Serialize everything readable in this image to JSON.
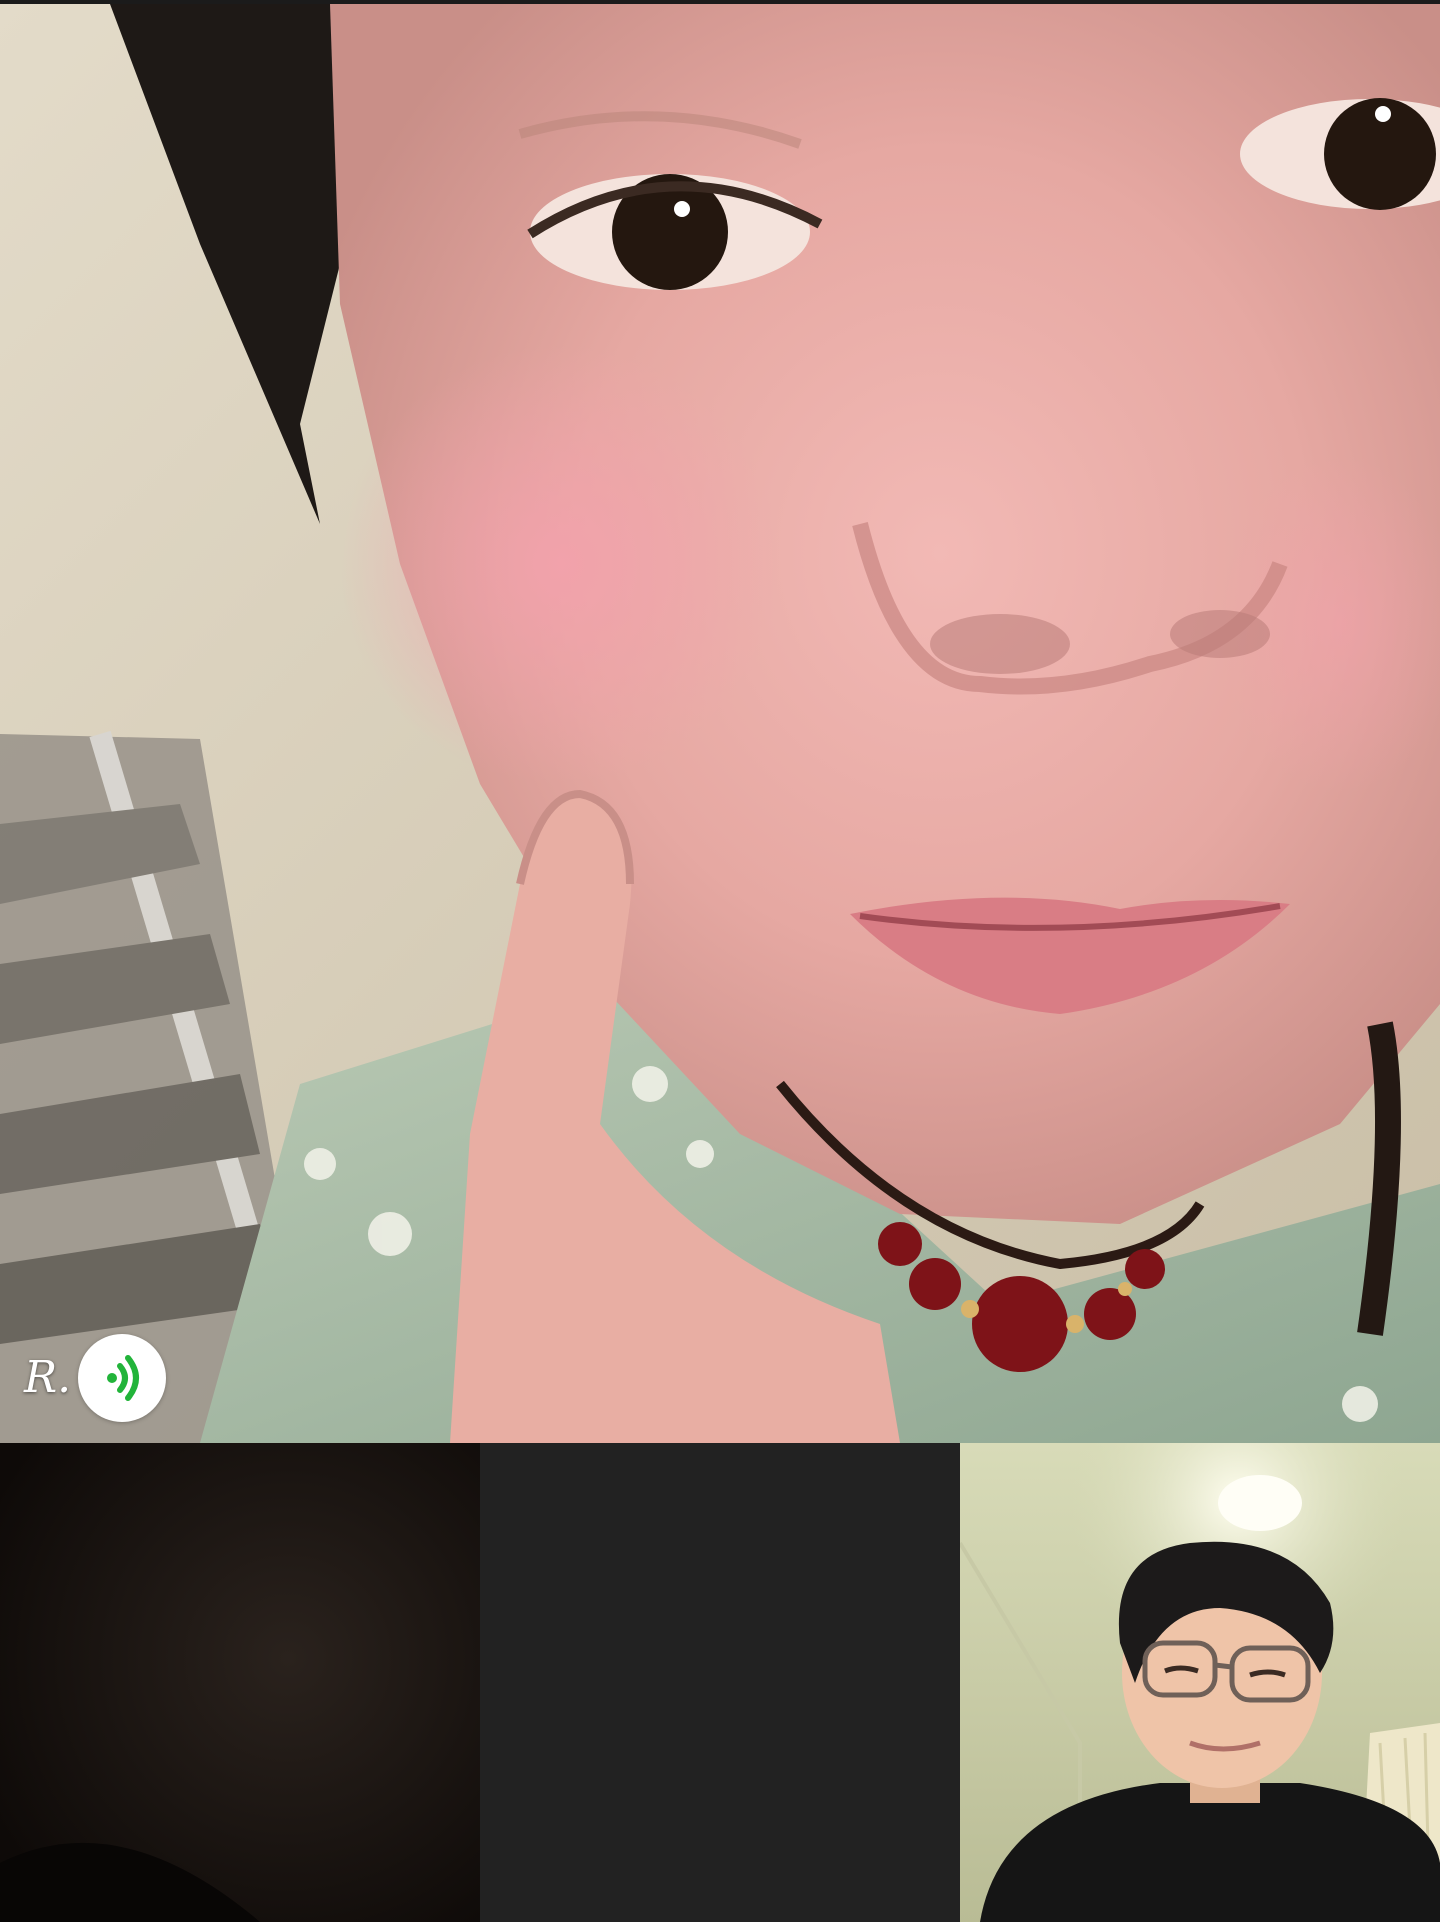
{
  "call": {
    "main_participant": {
      "name_label": "R.",
      "status_icon": "speaker-wave-icon"
    },
    "tiles": [
      {
        "id": "participant-camera-dark",
        "state": "dark video"
      },
      {
        "id": "participant-no-video",
        "state": "no video"
      },
      {
        "id": "self-preview",
        "state": "video"
      }
    ]
  },
  "colors": {
    "tile_background": "#232323",
    "speaking_indicator": "#22b43a",
    "badge_background": "#ffffff"
  }
}
